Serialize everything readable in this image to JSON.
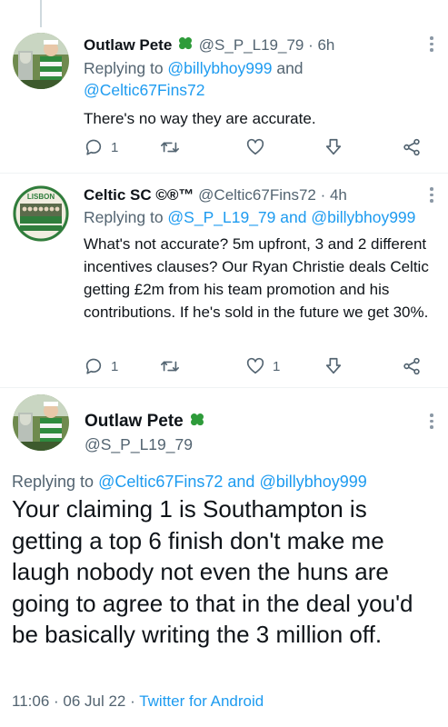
{
  "replies": [
    {
      "name": "Outlaw Pete",
      "handle": "@S_P_L19_79",
      "sep": " · ",
      "time": "6h",
      "replying_prefix": "Replying to ",
      "replying_to_1": "@billybhoy999",
      "replying_and": " and",
      "replying_to_2": "@Celtic67Fins72",
      "text": "There's no way they are accurate.",
      "reply_count": "1",
      "like_count": ""
    },
    {
      "name": "Celtic SC ©®™",
      "handle": "@Celtic67Fins72",
      "sep": " · ",
      "time": "4h",
      "replying_prefix": "Replying to ",
      "replying_to_1": "@S_P_L19_79",
      "replying_and": " and ",
      "replying_to_2": "@billybhoy999",
      "text": "What's not accurate? 5m upfront, 3 and 2 different incentives clauses? Our Ryan Christie deals Celtic getting £2m from his team promotion and his contributions. If he's sold in the future we get 30%.",
      "reply_count": "1",
      "like_count": "1",
      "avatar_text": "LISBON"
    }
  ],
  "main_tweet": {
    "name": "Outlaw Pete",
    "handle": "@S_P_L19_79",
    "replying_prefix": "Replying to ",
    "replying_to_1": "@Celtic67Fins72",
    "replying_and": " and ",
    "replying_to_2": "@billybhoy999",
    "text": "Your claiming 1 is Southampton is getting a top 6 finish don't make me laugh nobody not even the huns are going to agree to that in the deal you'd be basically writing the 3 million off.",
    "time": "11:06",
    "dot": " · ",
    "date": "06 Jul 22",
    "source": "Twitter for Android"
  },
  "colors": {
    "accent": "#1d9bf0",
    "muted": "#536471",
    "clover": "#2e9b3a"
  },
  "icons": [
    "reply-icon",
    "retweet-icon",
    "like-icon",
    "download-icon",
    "share-icon",
    "more-icon",
    "shamrock-icon"
  ]
}
